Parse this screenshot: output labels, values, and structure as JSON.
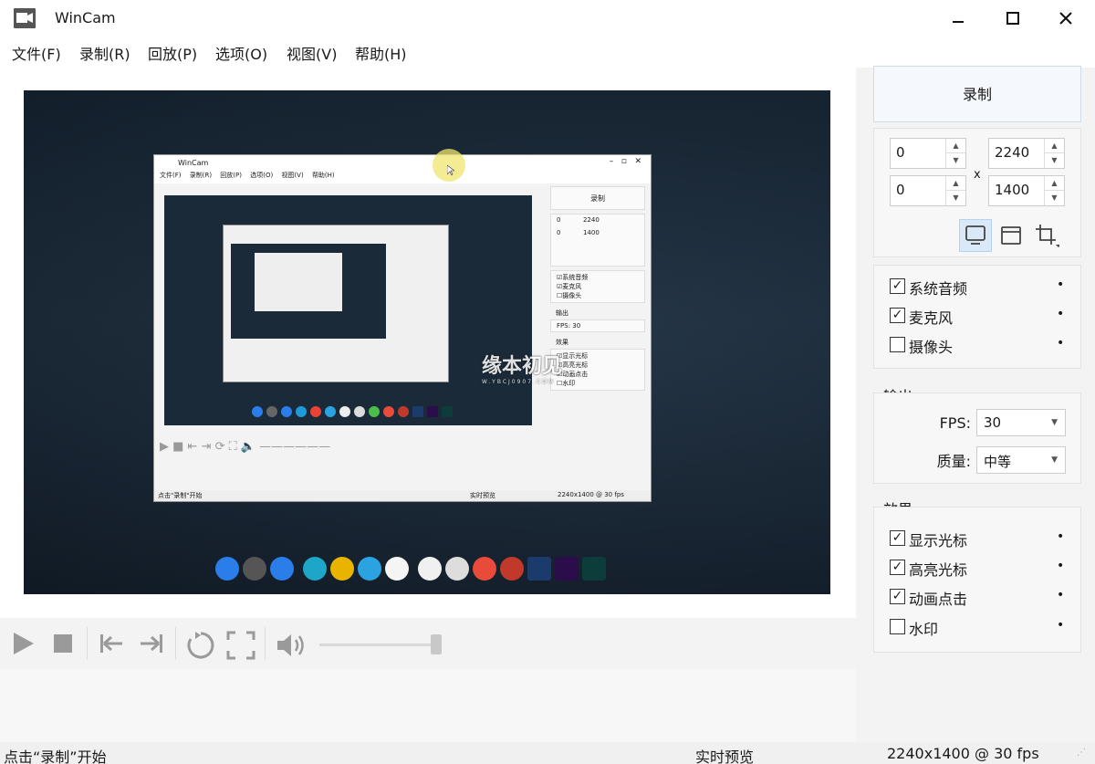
{
  "window": {
    "title": "WinCam"
  },
  "menu": [
    {
      "label": "文件(F)"
    },
    {
      "label": "录制(R)"
    },
    {
      "label": "回放(P)"
    },
    {
      "label": "选项(O)"
    },
    {
      "label": "视图(V)"
    },
    {
      "label": "帮助(H)"
    }
  ],
  "panel": {
    "record_label": "录制",
    "region": {
      "x": "0",
      "y": "0",
      "width": "2240",
      "height": "1400",
      "times": "x"
    },
    "audio": [
      {
        "label": "系统音频",
        "checked": "✓"
      },
      {
        "label": "麦克风",
        "checked": "✓"
      },
      {
        "label": "摄像头",
        "checked": ""
      }
    ],
    "output": {
      "title": "输出",
      "fps_label": "FPS:",
      "fps_value": "30",
      "quality_label": "质量:",
      "quality_value": "中等"
    },
    "effects": {
      "title": "效果",
      "items": [
        {
          "label": "显示光标",
          "checked": "✓"
        },
        {
          "label": "高亮光标",
          "checked": "✓"
        },
        {
          "label": "动画点击",
          "checked": "✓"
        },
        {
          "label": "水印",
          "checked": ""
        }
      ]
    }
  },
  "status": {
    "left": "点击“录制”开始",
    "middle": "实时预览",
    "right": "2240x1400 @ 30 fps"
  },
  "preview": {
    "inner_title": "WinCam",
    "inner_menu": [
      "文件(F)",
      "录制(R)",
      "回放(P)",
      "选项(O)",
      "视图(V)",
      "帮助(H)"
    ],
    "inner_record": "录制",
    "inner_region": [
      "0",
      "2240",
      "0",
      "1400"
    ],
    "inner_audio": [
      "☑系统音频",
      "☑麦克风",
      "☐摄像头"
    ],
    "inner_output": "输出",
    "inner_fps": "FPS: 30",
    "inner_effects_title": "效果",
    "inner_effects": [
      "☑显示光标",
      "☑高亮光标",
      "☑动画点击",
      "☐水印"
    ],
    "inner_status": [
      "点击\"录制\"开始",
      "实时预览",
      "2240x1400 @ 30 fps"
    ],
    "watermark": "缘本初见",
    "watermark_url": "W.YBCJ0907.COM"
  },
  "colors": {
    "accent": "#cfdbe8",
    "active_mode": "#d9e9f8"
  }
}
